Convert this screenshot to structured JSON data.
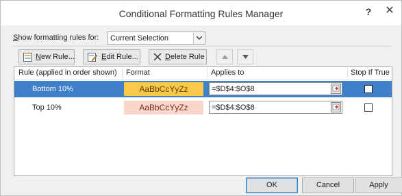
{
  "dialog": {
    "title": "Conditional Formatting Rules Manager",
    "help_glyph": "?",
    "close_glyph": "✕"
  },
  "show_rules": {
    "label_prefix": "S",
    "label_rest": "how formatting rules for:",
    "selected": "Current Selection"
  },
  "toolbar": {
    "new_rule_u": "N",
    "new_rule_rest": "ew Rule...",
    "edit_rule_u": "E",
    "edit_rule_rest": "dit Rule...",
    "delete_rule_u": "D",
    "delete_rule_rest": "elete Rule"
  },
  "grid": {
    "headers": {
      "rule": "Rule (applied in order shown)",
      "format": "Format",
      "applies_to": "Applies to",
      "stop_if_true": "Stop If True"
    },
    "rows": [
      {
        "rule": "Bottom 10%",
        "format_preview": "AaBbCcYyZz",
        "applies_to": "=$D$4:$O$8",
        "stop_if_true": false,
        "selected": true,
        "preview_bg": "#fbc94a",
        "preview_fg": "#5a4200"
      },
      {
        "rule": "Top 10%",
        "format_preview": "AaBbCcYyZz",
        "applies_to": "=$D$4:$O$8",
        "stop_if_true": false,
        "selected": false,
        "preview_bg": "#f9d6cb",
        "preview_fg": "#7a2d1a"
      }
    ]
  },
  "buttons": {
    "ok": "OK",
    "cancel": "Cancel",
    "apply": "Apply"
  },
  "colors": {
    "selection": "#3f80c9"
  }
}
